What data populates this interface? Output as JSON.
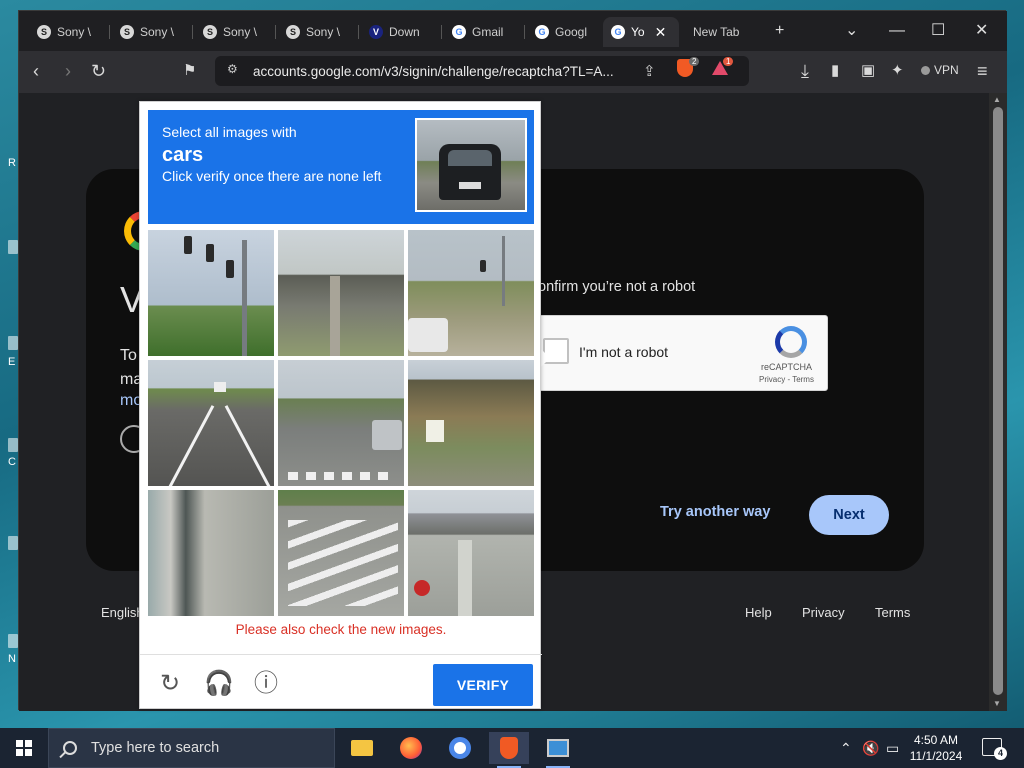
{
  "browser": {
    "tabs": [
      {
        "label": "Sony \\",
        "fav": "S"
      },
      {
        "label": "Sony \\",
        "fav": "S"
      },
      {
        "label": "Sony \\",
        "fav": "S"
      },
      {
        "label": "Sony \\",
        "fav": "S"
      },
      {
        "label": "Down",
        "fav": "V"
      },
      {
        "label": "Gmail",
        "fav": "G"
      },
      {
        "label": "Googl",
        "fav": "G"
      },
      {
        "label": "Yo",
        "fav": "G"
      },
      {
        "label": "New Tab",
        "fav": ""
      }
    ],
    "new_tab_icon": "+",
    "url": "accounts.google.com/v3/signin/challenge/recaptcha?TL=A...",
    "vpn_label": "VPN",
    "shields_badge": "2",
    "rewards_badge": "1"
  },
  "page": {
    "heading_partial": "V",
    "text_partial": "To",
    "text_partial2": "ma",
    "link_partial": "mo",
    "confirm_text": "onfirm you’re not a robot",
    "recaptcha": {
      "label": "I'm not a robot",
      "brand": "reCAPTCHA",
      "terms": "Privacy - Terms"
    },
    "try_another": "Try another way",
    "next": "Next",
    "footer": {
      "language": "English",
      "help": "Help",
      "privacy": "Privacy",
      "terms": "Terms"
    }
  },
  "challenge": {
    "line1": "Select all images with",
    "target": "cars",
    "line2": "Click verify once there are none left",
    "warning": "Please also check the new images.",
    "verify": "VERIFY"
  },
  "desktop": {
    "letters": [
      "R",
      "E",
      "C",
      "N"
    ]
  },
  "taskbar": {
    "search_placeholder": "Type here to search",
    "time": "4:50 AM",
    "date": "11/1/2024",
    "notification_count": "4"
  }
}
